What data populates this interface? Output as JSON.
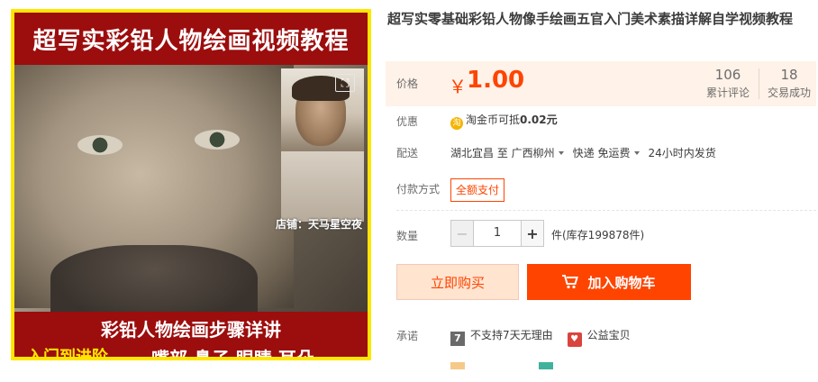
{
  "product": {
    "title": "超写实零基础彩铅人物像手绘画五官入门美术素描详解自学视频教程",
    "image": {
      "top_banner": "超写实彩铅人物绘画视频教程",
      "shop_label": "店铺：天马星空夜",
      "bottom_line1": "彩铅人物绘画步骤详讲",
      "bottom_line2_left": "入门到进阶",
      "bottom_line2_right": "嘴部 鼻子 眼睛 耳朵"
    }
  },
  "price": {
    "label": "价格",
    "symbol": "￥",
    "value": "1.00",
    "reviews_count": "106",
    "reviews_label": "累计评论",
    "sales_count": "18",
    "sales_label": "交易成功"
  },
  "discount": {
    "label": "优惠",
    "icon_text": "淘",
    "text_prefix": "淘金币可抵",
    "amount": "0.02元"
  },
  "shipping": {
    "label": "配送",
    "from": "湖北宜昌 至",
    "to": "广西柳州",
    "method": "快递 免运费",
    "dispatch": "24小时内发货"
  },
  "payment": {
    "label": "付款方式",
    "tag": "全额支付"
  },
  "quantity": {
    "label": "数量",
    "value": "1",
    "minus": "−",
    "plus": "+",
    "stock_text": "件(库存199878件)"
  },
  "actions": {
    "buy_now": "立即购买",
    "add_to_cart": "加入购物车"
  },
  "promise": {
    "label": "承诺",
    "item1_icon": "7",
    "item1_text": "不支持7天无理由",
    "item2_text": "公益宝贝"
  },
  "colors": {
    "accent": "#ff4400",
    "price_bg": "#fff2e8",
    "image_frame": "#ffe600",
    "banner_red": "#9c0d0d"
  }
}
